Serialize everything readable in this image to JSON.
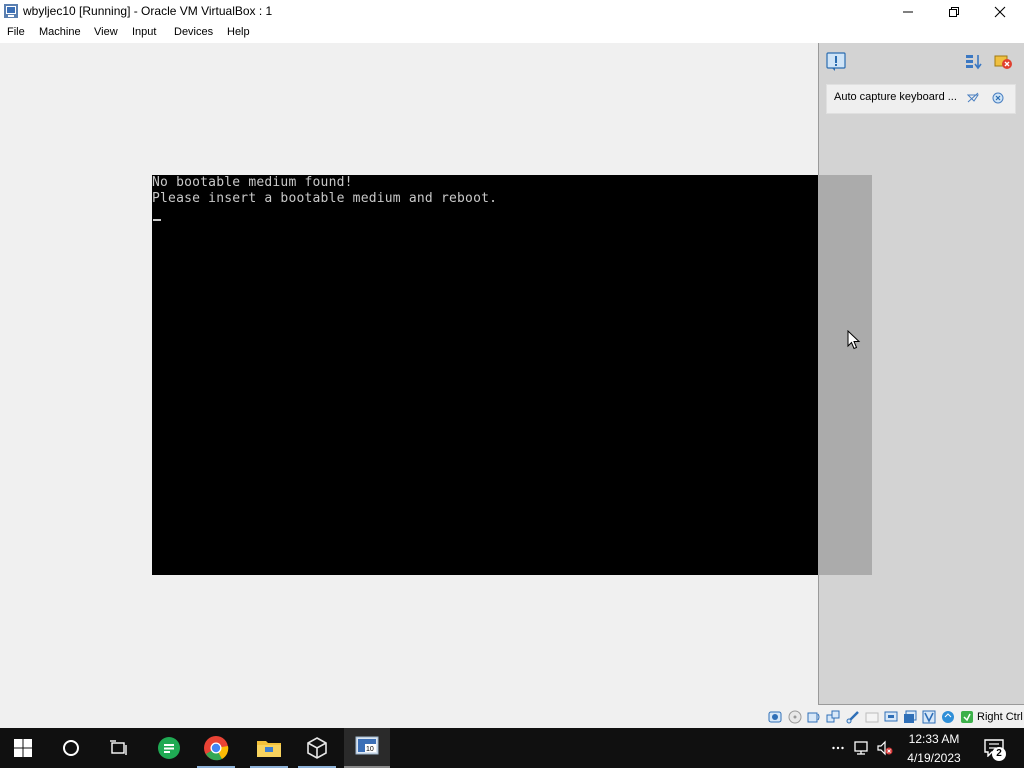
{
  "window": {
    "title": "wbyljec10 [Running] - Oracle VM VirtualBox : 1"
  },
  "menu": [
    "File",
    "Machine",
    "View",
    "Input",
    "Devices",
    "Help"
  ],
  "console": {
    "line1": "No bootable medium found!",
    "line2": "Please insert a bootable medium and reboot."
  },
  "notification": {
    "text": "Auto capture keyboard ..."
  },
  "statusbar": {
    "host_key": "Right Ctrl"
  },
  "taskbar": {
    "time": "12:33 AM",
    "date": "4/19/2023",
    "notification_count": "2"
  }
}
